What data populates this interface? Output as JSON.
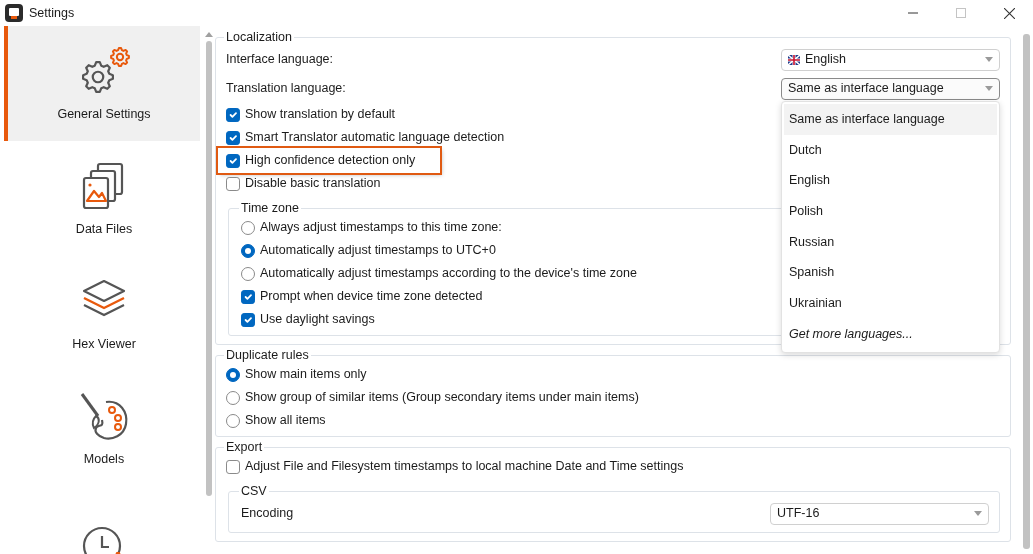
{
  "window": {
    "title": "Settings"
  },
  "sidebar": {
    "items": [
      {
        "kind": "gears",
        "label": "General Settings",
        "selected": true
      },
      {
        "kind": "files",
        "label": "Data Files",
        "selected": false
      },
      {
        "kind": "layers",
        "label": "Hex Viewer",
        "selected": false
      },
      {
        "kind": "palette",
        "label": "Models",
        "selected": false
      },
      {
        "kind": "clock",
        "selected": false
      }
    ]
  },
  "sections": [
    {
      "title": "Localization",
      "items": [
        {
          "kind": "select",
          "label": "Interface language:",
          "value": "English",
          "flag": true
        },
        {
          "kind": "select",
          "label": "Translation language:",
          "value": "Same as interface language",
          "expanded": true,
          "options": [
            {
              "label": "Same as interface language",
              "selected": true
            },
            {
              "label": "Dutch",
              "selected": false
            },
            {
              "label": "English",
              "selected": false
            },
            {
              "label": "Polish",
              "selected": false
            },
            {
              "label": "Russian",
              "selected": false
            },
            {
              "label": "Spanish",
              "selected": false
            },
            {
              "label": "Ukrainian",
              "selected": false
            },
            {
              "label": "Get more languages...",
              "kind": "link",
              "selected": false
            }
          ]
        },
        {
          "kind": "checkbox",
          "label": "Show translation by default",
          "checked": true
        },
        {
          "kind": "checkbox",
          "label": "Smart Translator automatic language detection",
          "checked": true
        },
        {
          "kind": "checkbox",
          "label": "High confidence detection only",
          "checked": true,
          "highlighted": true
        },
        {
          "kind": "checkbox",
          "label": "Disable basic translation",
          "checked": false
        },
        {
          "kind": "group",
          "title": "Time zone",
          "items": [
            {
              "kind": "radio",
              "label": "Always adjust timestamps to this time zone:",
              "selected": false
            },
            {
              "kind": "radio",
              "label": "Automatically adjust timestamps to UTC+0",
              "selected": true
            },
            {
              "kind": "radio",
              "label": "Automatically adjust timestamps according to the device's time zone",
              "selected": false
            },
            {
              "kind": "checkbox",
              "label": "Prompt when device time zone detected",
              "checked": true
            },
            {
              "kind": "checkbox",
              "label": "Use daylight savings",
              "checked": true
            }
          ]
        }
      ]
    },
    {
      "title": "Duplicate rules",
      "items": [
        {
          "kind": "radio",
          "label": "Show main items only",
          "selected": true
        },
        {
          "kind": "radio",
          "label": "Show group of similar items (Group secondary items under main items)",
          "selected": false
        },
        {
          "kind": "radio",
          "label": "Show all items",
          "selected": false
        }
      ]
    },
    {
      "title": "Export",
      "items": [
        {
          "kind": "checkbox",
          "label": "Adjust File and Filesystem timestamps to local machine Date and Time settings",
          "checked": false
        },
        {
          "kind": "group",
          "title": "CSV",
          "items": [
            {
              "kind": "select",
              "label": "Encoding",
              "value": "UTF-16"
            }
          ]
        }
      ]
    }
  ]
}
